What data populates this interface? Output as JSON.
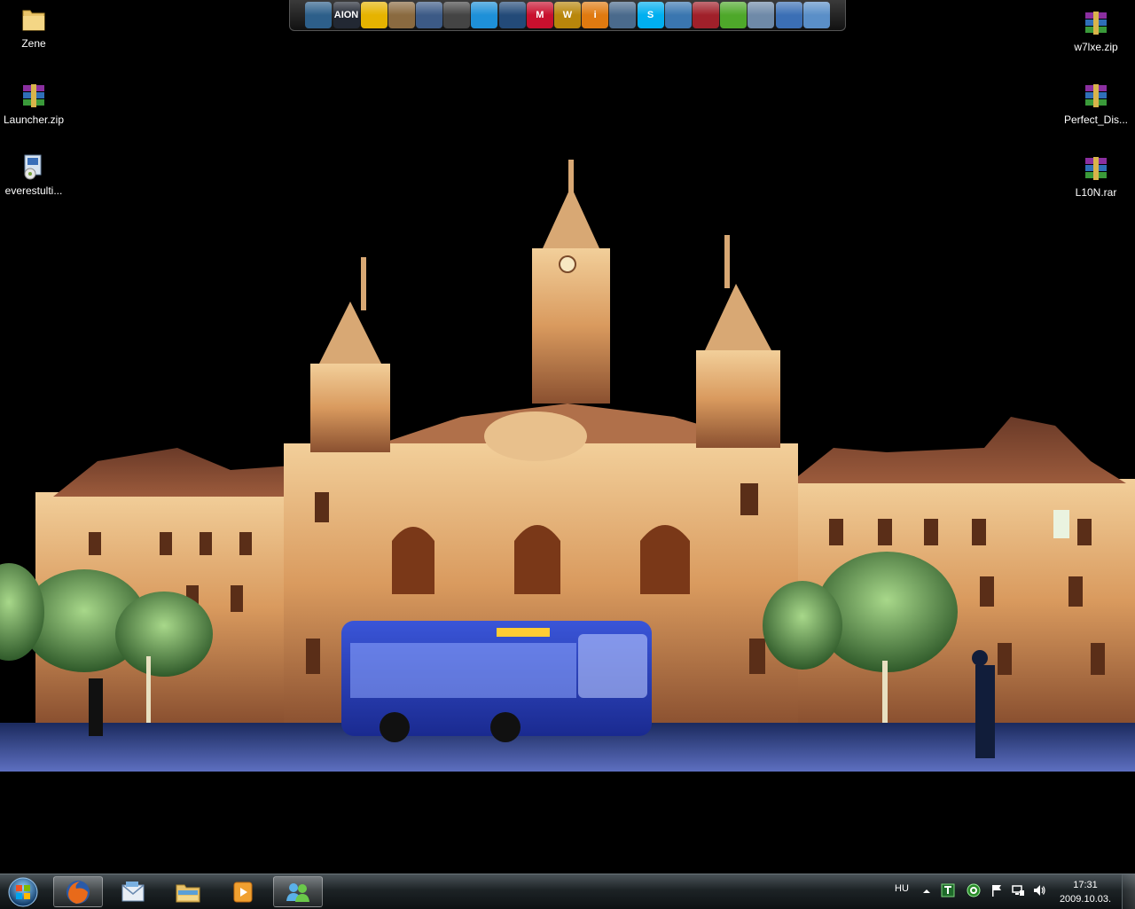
{
  "desktop": {
    "icons_left": [
      {
        "label": "Zene",
        "icon": "folder-icon"
      },
      {
        "label": "Launcher.zip",
        "icon": "winrar-archive-icon"
      },
      {
        "label": "everestulti...",
        "icon": "installer-icon"
      }
    ],
    "icons_right": [
      {
        "label": "w7lxe.zip",
        "icon": "winrar-archive-icon"
      },
      {
        "label": "Perfect_Dis...",
        "icon": "winrar-archive-icon"
      },
      {
        "label": "L10N.rar",
        "icon": "winrar-archive-icon"
      }
    ],
    "wallpaper": "night-town-hall-with-blue-bus"
  },
  "dock": {
    "items": [
      {
        "name": "monitor-icon",
        "text": "",
        "color": "#2d5f8a"
      },
      {
        "name": "aion-game-icon",
        "text": "AION",
        "color": "#222833"
      },
      {
        "name": "bus-icon",
        "text": "",
        "color": "#e6b300"
      },
      {
        "name": "train-icon",
        "text": "",
        "color": "#8a6a40"
      },
      {
        "name": "game-icon",
        "text": "",
        "color": "#3c5a86"
      },
      {
        "name": "car-icon",
        "text": "",
        "color": "#444"
      },
      {
        "name": "messenger-icon",
        "text": "",
        "color": "#1e90d8"
      },
      {
        "name": "bluetooth-icon",
        "text": "",
        "color": "#234a78"
      },
      {
        "name": "malwarebytes-icon",
        "text": "M",
        "color": "#c8102e"
      },
      {
        "name": "warcraft-icon",
        "text": "W",
        "color": "#b8860b"
      },
      {
        "name": "info-icon",
        "text": "i",
        "color": "#e07a10"
      },
      {
        "name": "apps-grid-icon",
        "text": "",
        "color": "#4a6a8c"
      },
      {
        "name": "skype-icon",
        "text": "S",
        "color": "#00aff0"
      },
      {
        "name": "network-icon",
        "text": "",
        "color": "#3a76b0"
      },
      {
        "name": "phone-icon",
        "text": "",
        "color": "#a0202a"
      },
      {
        "name": "utorrent-icon",
        "text": "",
        "color": "#4ea82a"
      },
      {
        "name": "settings-icon",
        "text": "",
        "color": "#6f8aa8"
      },
      {
        "name": "tools-icon",
        "text": "",
        "color": "#3b6fb5"
      },
      {
        "name": "control-panel-icon",
        "text": "",
        "color": "#5a8fc8"
      }
    ]
  },
  "taskbar": {
    "pinned": [
      {
        "name": "firefox-icon",
        "active": true
      },
      {
        "name": "email-icon",
        "active": false
      },
      {
        "name": "explorer-icon",
        "active": false
      },
      {
        "name": "media-player-icon",
        "active": false
      },
      {
        "name": "messenger-contacts-icon",
        "active": true
      }
    ],
    "tray": {
      "language": "HU",
      "time": "17:31",
      "date": "2009.10.03."
    }
  }
}
